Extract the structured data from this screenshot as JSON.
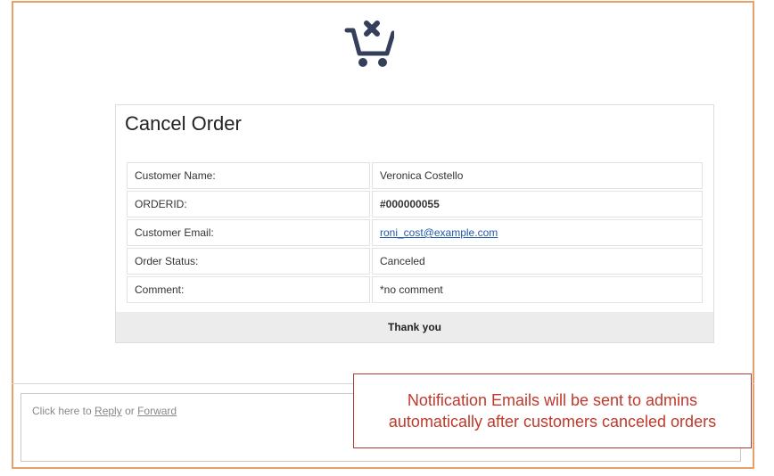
{
  "header": {
    "icon": "cart-cancel-icon",
    "icon_color": "#34405a",
    "frame_color": "#e8a06a"
  },
  "order": {
    "title": "Cancel Order",
    "rows": [
      {
        "label": "Customer Name:",
        "value": "Veronica Costello"
      },
      {
        "label": "ORDERID:",
        "value": "#000000055"
      },
      {
        "label": "Customer Email:",
        "value": "roni_cost@example.com"
      },
      {
        "label": "Order Status:",
        "value": "Canceled"
      },
      {
        "label": "Comment:",
        "value": "*no comment"
      }
    ],
    "footer": "Thank you"
  },
  "reply": {
    "prefix": "Click here to",
    "reply_label": "Reply",
    "separator": "or",
    "forward_label": "Forward"
  },
  "notice": {
    "line1": "Notification Emails will be sent to admins",
    "line2": "automatically after customers canceled orders",
    "color": "#c0392b"
  }
}
